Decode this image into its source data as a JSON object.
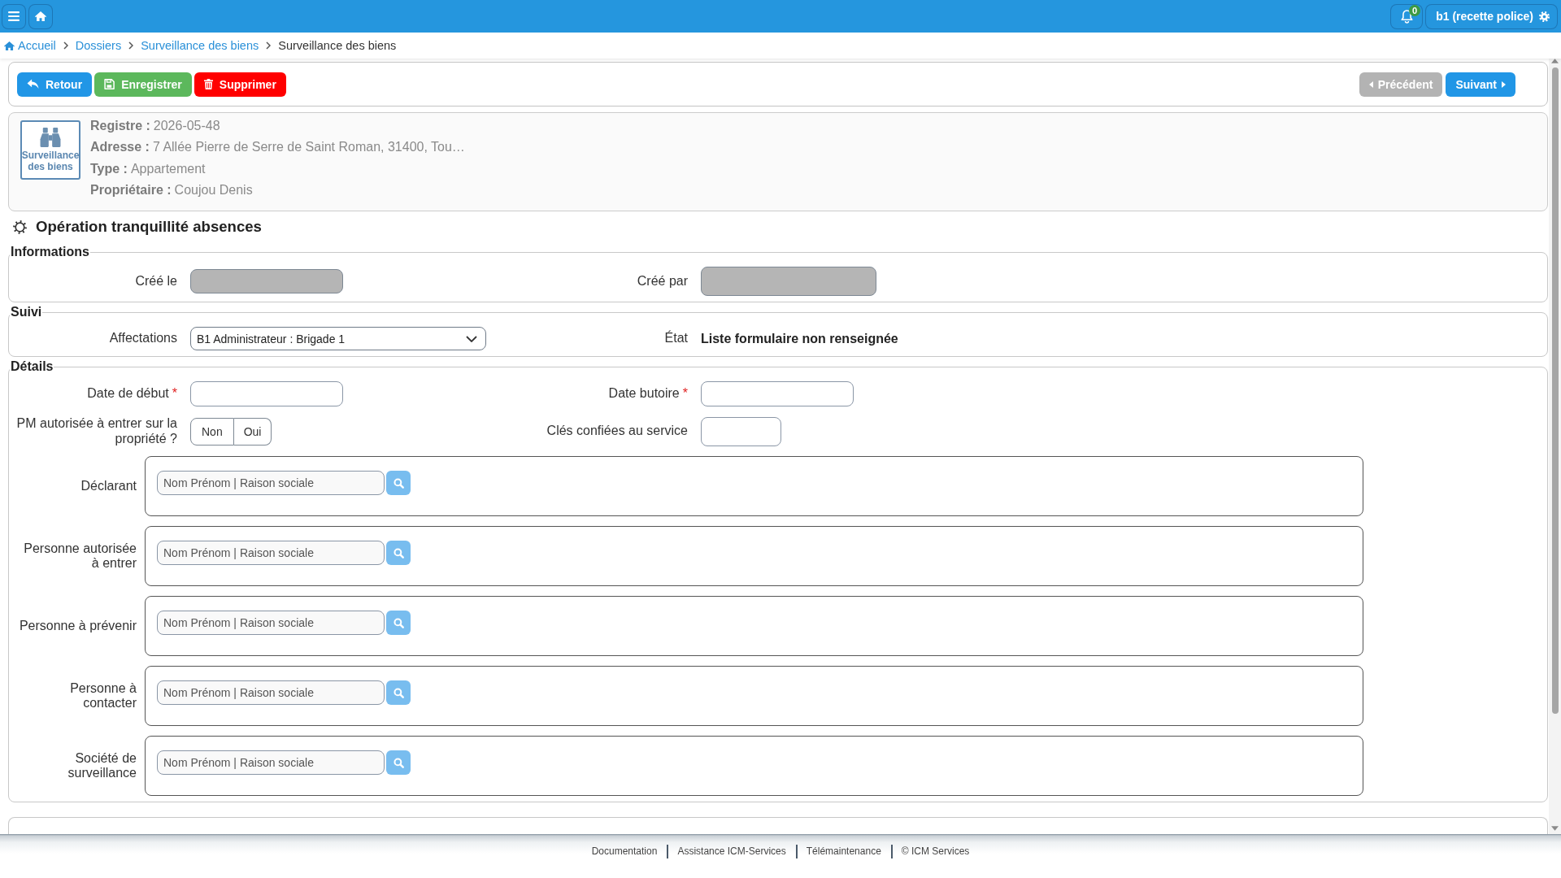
{
  "top_bar": {
    "notification_count": "0",
    "user_menu": "b1 (recette police)"
  },
  "breadcrumb": [
    {
      "label": "Accueil",
      "kind": "home"
    },
    {
      "label": "Dossiers",
      "kind": "link"
    },
    {
      "label": "Surveillance des biens",
      "kind": "link"
    },
    {
      "label": "Surveillance des biens",
      "kind": "current"
    }
  ],
  "toolbar": {
    "actions": [
      {
        "label": "Retour",
        "kind": "back"
      },
      {
        "label": "Enregistrer",
        "kind": "save"
      },
      {
        "label": "Supprimer",
        "kind": "delete"
      }
    ],
    "navigation": [
      {
        "label": "Précédent",
        "kind": "previous",
        "disabled": true
      },
      {
        "label": "Suivant",
        "kind": "next",
        "disabled": false
      }
    ]
  },
  "record": {
    "type_label": "Surveillance des biens",
    "fields": [
      {
        "label": "Registre :",
        "value": "2026-05-48"
      },
      {
        "label": "Adresse :",
        "value": "7 Allée Pierre de Serre de Saint Roman, 31400, Tou…"
      },
      {
        "label": "Type :",
        "value": "Appartement"
      },
      {
        "label": "Propriétaire :",
        "value": "Coujou Denis"
      }
    ]
  },
  "form": {
    "title": "Opération tranquillité absences",
    "sections": [
      {
        "legend": "Informations",
        "rows": [
          [
            {
              "label": "Créé le",
              "kind": "input",
              "disabled": true
            },
            {
              "label": "Créé par",
              "kind": "input",
              "disabled": true
            }
          ]
        ]
      },
      {
        "legend": "Suivi",
        "rows": [
          [
            {
              "label": "Affectations",
              "kind": "select",
              "value": "B1 Administrateur : Brigade 1"
            },
            {
              "label": "État",
              "kind": "text",
              "value": "Liste formulaire non renseignée"
            }
          ]
        ]
      },
      {
        "legend": "Détails",
        "rows": [
          [
            {
              "label": "Date de début",
              "required_mark": "*",
              "kind": "input",
              "disabled": false
            },
            {
              "label": "Date butoire",
              "required_mark": "*",
              "kind": "input",
              "disabled": false
            }
          ],
          [
            {
              "label": "PM autorisée à entrer sur la propriété ?",
              "kind": "toggle",
              "options": [
                {
                  "label": "Non",
                  "selected": false
                },
                {
                  "label": "Oui",
                  "selected": false
                }
              ]
            },
            {
              "label": "Clés confiées au service",
              "kind": "input",
              "disabled": false
            }
          ]
        ],
        "contacts": [
          {
            "label": "Déclarant",
            "placeholder": "Nom Prénom | Raison sociale"
          },
          {
            "label": "Personne autorisée à entrer",
            "placeholder": "Nom Prénom | Raison sociale"
          },
          {
            "label": "Personne à prévenir",
            "placeholder": "Nom Prénom | Raison sociale"
          },
          {
            "label": "Personne à contacter",
            "placeholder": "Nom Prénom | Raison sociale"
          },
          {
            "label": "Société de surveillance",
            "placeholder": "Nom Prénom | Raison sociale"
          }
        ]
      }
    ]
  },
  "footer": {
    "links": [
      "Documentation",
      "Assistance ICM-Services",
      "Télémaintenance",
      "© ICM Services"
    ]
  }
}
